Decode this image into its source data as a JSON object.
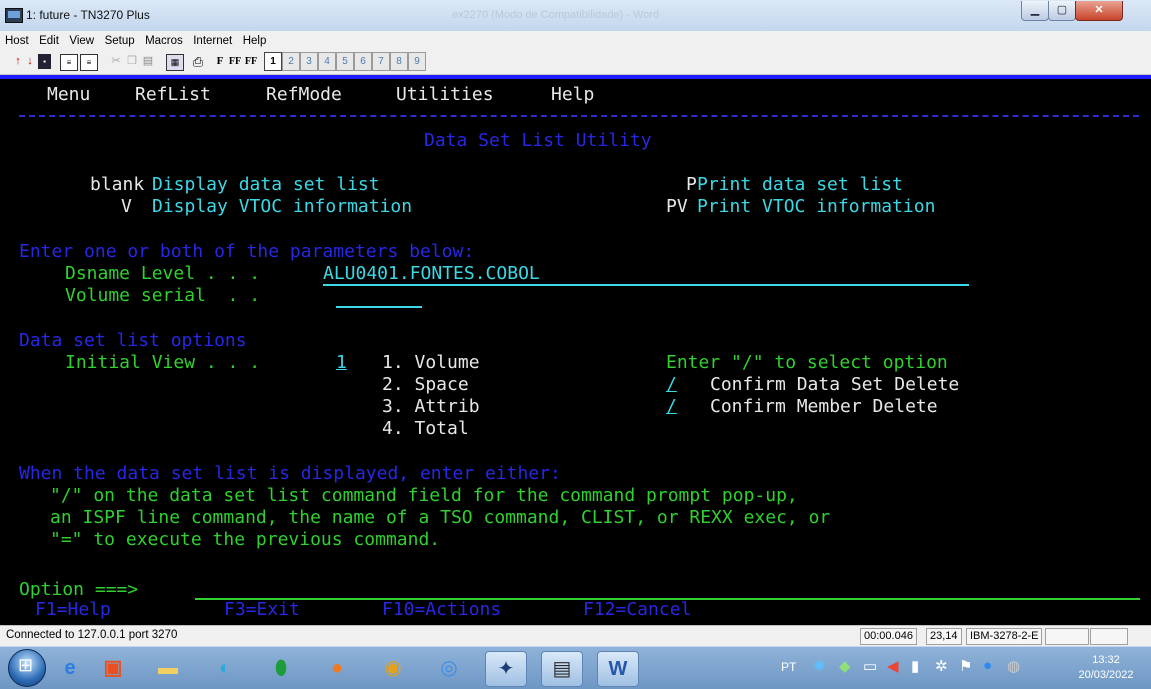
{
  "window": {
    "title": "1: future - TN3270 Plus",
    "background_title": "ex2270 (Modo de Compatibilidade) - Word"
  },
  "menubar": [
    "Host",
    "Edit",
    "View",
    "Setup",
    "Macros",
    "Internet",
    "Help"
  ],
  "toolbar": {
    "sessions": [
      "1",
      "2",
      "3",
      "4",
      "5",
      "6",
      "7",
      "8",
      "9"
    ],
    "active_session": "1",
    "font_buttons": [
      "F",
      "FF",
      "FF"
    ]
  },
  "terminal": {
    "menu": [
      "Menu",
      "RefList",
      "RefMode",
      "Utilities",
      "Help"
    ],
    "title": "Data Set List Utility",
    "actions": [
      {
        "key": "blank",
        "label": "Display data set list"
      },
      {
        "key": "P",
        "label": "Print data set list"
      },
      {
        "key": "V",
        "label": "Display VTOC information"
      },
      {
        "key": "PV",
        "label": "Print VTOC information"
      }
    ],
    "params_heading": "Enter one or both of the parameters below:",
    "dsname_label": "Dsname Level . . .",
    "dsname_value": "ALU0401.FONTES.COBOL",
    "volume_label": "Volume serial  . .",
    "volume_value": "",
    "options_heading": "Data set list options",
    "initial_view_label": "Initial View . . .",
    "initial_view_value": "1",
    "views": [
      "1. Volume",
      "2. Space",
      "3. Attrib",
      "4. Total"
    ],
    "select_hint": "Enter \"/\" to select option",
    "confirm_options": [
      {
        "mark": "/",
        "label": "Confirm Data Set Delete"
      },
      {
        "mark": "/",
        "label": "Confirm Member Delete"
      }
    ],
    "info_heading": "When the data set list is displayed, enter either:",
    "info_lines": [
      "\"/\" on the data set list command field for the command prompt pop-up,",
      "an ISPF line command, the name of a TSO command, CLIST, or REXX exec, or",
      "\"=\" to execute the previous command."
    ],
    "option_prompt": "Option ===>",
    "option_value": "",
    "fkeys": [
      "F1=Help",
      "F3=Exit",
      "F10=Actions",
      "F12=Cancel"
    ]
  },
  "status": {
    "message": "Connected to 127.0.0.1 port 3270",
    "time_elapsed": "00:00.046",
    "cursor": "23,14",
    "model": "IBM-3278-2-E"
  },
  "taskbar": {
    "language": "PT",
    "time": "13:32",
    "date": "20/03/2022",
    "apps": [
      "ie-icon",
      "office-icon",
      "folder-icon",
      "edge-icon",
      "vpn-icon",
      "firefox-icon",
      "chrome-icon",
      "chromium-icon",
      "tool-icon",
      "tn3270-icon",
      "word-icon"
    ],
    "colors": {
      "terminal_bg": "#000000",
      "turquoise": "#3cd8e6",
      "blue": "#2727e6",
      "green": "#2fd02f",
      "white": "#e8e8e8"
    }
  }
}
